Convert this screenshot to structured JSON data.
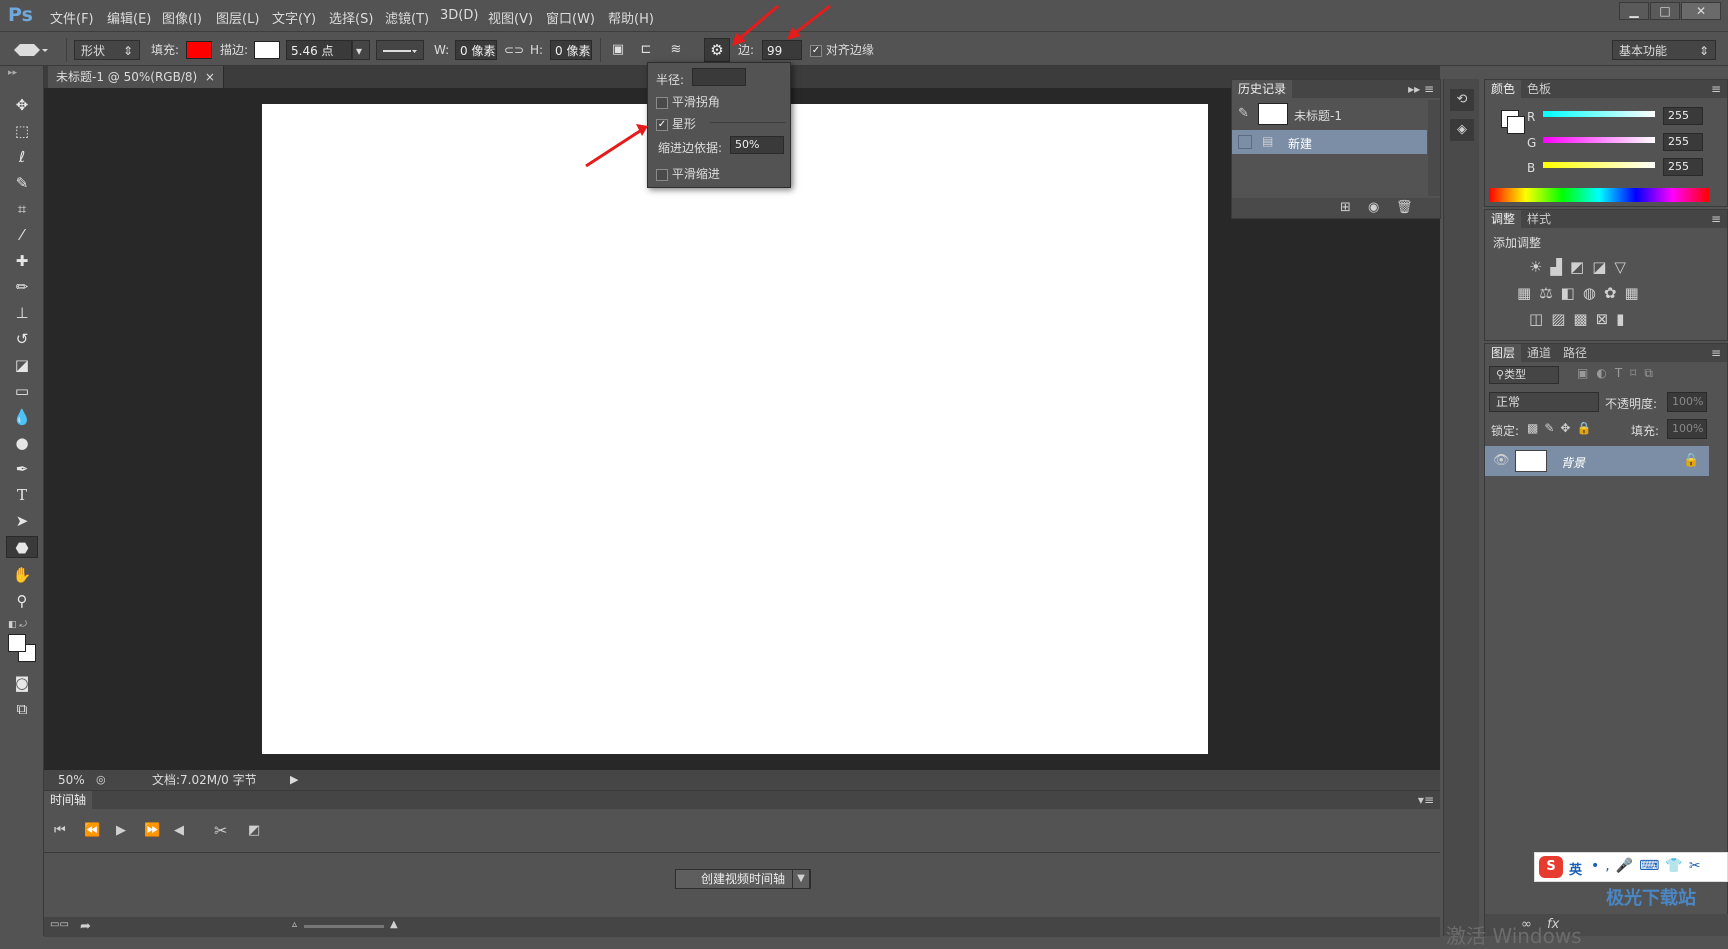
{
  "app": {
    "logo": "Ps"
  },
  "menu": [
    "文件(F)",
    "编辑(E)",
    "图像(I)",
    "图层(L)",
    "文字(Y)",
    "选择(S)",
    "滤镜(T)",
    "3D(D)",
    "视图(V)",
    "窗口(W)",
    "帮助(H)"
  ],
  "window_controls": {
    "minimize": "▁",
    "maximize": "□",
    "close": "✕"
  },
  "options": {
    "shape_mode": "形状",
    "fill_label": "填充:",
    "fill_color": "#ff0000",
    "stroke_label": "描边:",
    "stroke_width": "5.46 点",
    "w_label": "W:",
    "w_value": "0 像素",
    "h_label": "H:",
    "h_value": "0 像素",
    "sides_label": "边:",
    "sides_value": "99",
    "align_edges": "对齐边缘",
    "workspace": "基本功能"
  },
  "popup": {
    "radius_label": "半径:",
    "smooth_corners": "平滑拐角",
    "star": "星形",
    "indent_label": "缩进边依据:",
    "indent_value": "50%",
    "smooth_indents": "平滑缩进"
  },
  "document": {
    "tab_title": "未标题-1 @ 50%(RGB/8)",
    "tab_close": "×"
  },
  "status": {
    "zoom": "50%",
    "doc_info": "文档:7.02M/0 字节"
  },
  "timeline": {
    "title": "时间轴",
    "create_button": "创建视频时间轴"
  },
  "history": {
    "title": "历史记录",
    "items": [
      "未标题-1",
      "新建"
    ]
  },
  "color_panel": {
    "tabs": [
      "颜色",
      "色板"
    ],
    "channels": [
      {
        "label": "R",
        "value": "255",
        "color": "#00ffff"
      },
      {
        "label": "G",
        "value": "255",
        "color": "#ff00ff"
      },
      {
        "label": "B",
        "value": "255",
        "color": "#ffff00"
      }
    ]
  },
  "adjust_panel": {
    "tabs": [
      "调整",
      "样式"
    ],
    "title": "添加调整"
  },
  "layers_panel": {
    "tabs": [
      "图层",
      "通道",
      "路径"
    ],
    "filter_kind": "类型",
    "blend_mode": "正常",
    "opacity_label": "不透明度:",
    "opacity_value": "100%",
    "lock_label": "锁定:",
    "fill_label": "填充:",
    "fill_value": "100%",
    "layer_name": "背景"
  },
  "ime": {
    "logo": "S",
    "mode": "英"
  },
  "watermark": {
    "site": "极光下载站",
    "activate": "激活 Windows"
  }
}
